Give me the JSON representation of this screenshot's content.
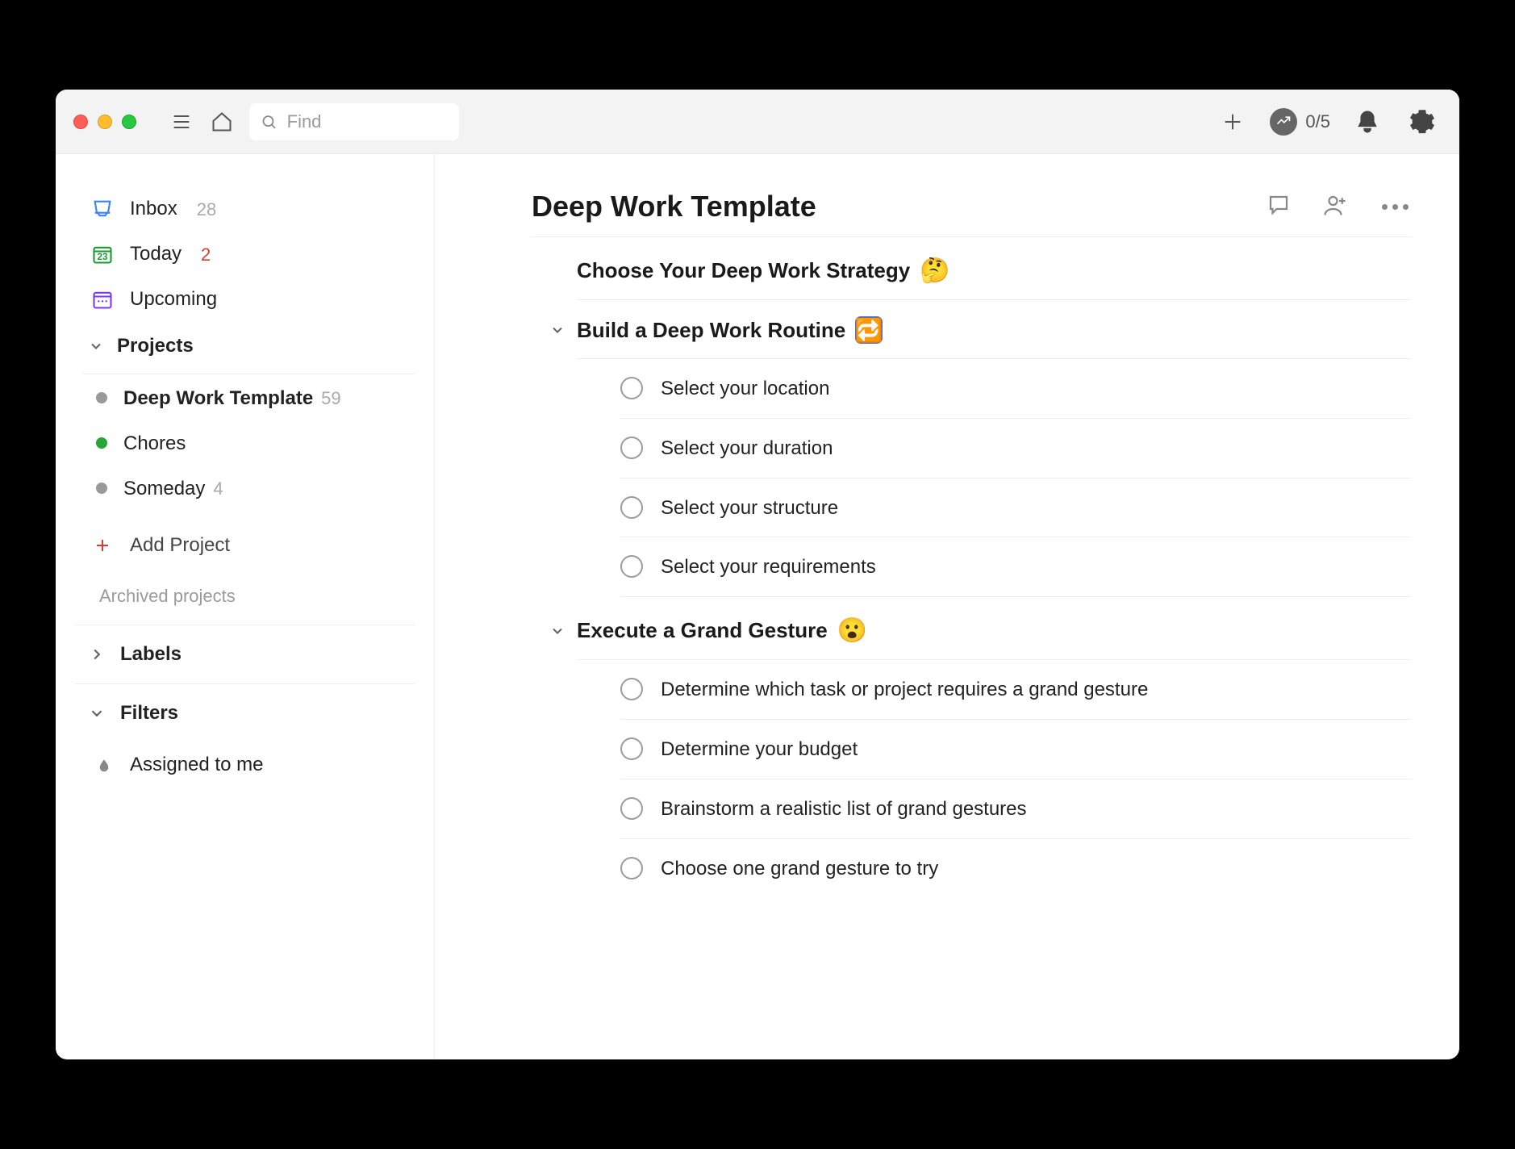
{
  "search": {
    "placeholder": "Find"
  },
  "productivity": {
    "label": "0/5"
  },
  "sidebar": {
    "inbox": {
      "label": "Inbox",
      "count": "28"
    },
    "today": {
      "label": "Today",
      "count": "2"
    },
    "upcoming": {
      "label": "Upcoming"
    },
    "projects_header": "Projects",
    "projects": [
      {
        "name": "Deep Work Template",
        "count": "59",
        "color": "#999",
        "active": true
      },
      {
        "name": "Chores",
        "count": "",
        "color": "#26a637",
        "active": false
      },
      {
        "name": "Someday",
        "count": "4",
        "color": "#999",
        "active": false
      }
    ],
    "add_project": "Add Project",
    "archived": "Archived projects",
    "labels_header": "Labels",
    "filters_header": "Filters",
    "filters": [
      {
        "label": "Assigned to me"
      }
    ]
  },
  "main": {
    "title": "Deep Work Template",
    "sections": [
      {
        "title": "Choose Your Deep Work Strategy",
        "emoji": "🤔",
        "expanded": false,
        "tasks": []
      },
      {
        "title": "Build a Deep Work Routine",
        "emoji_badge": "🔁",
        "expanded": true,
        "tasks": [
          "Select your location",
          "Select your duration",
          "Select your structure",
          "Select your requirements"
        ]
      },
      {
        "title": "Execute a Grand Gesture",
        "emoji": "😮",
        "expanded": true,
        "tasks": [
          "Determine which task or project requires a grand gesture",
          "Determine your budget",
          "Brainstorm a realistic list of grand gestures",
          "Choose one grand gesture to try"
        ]
      }
    ]
  }
}
